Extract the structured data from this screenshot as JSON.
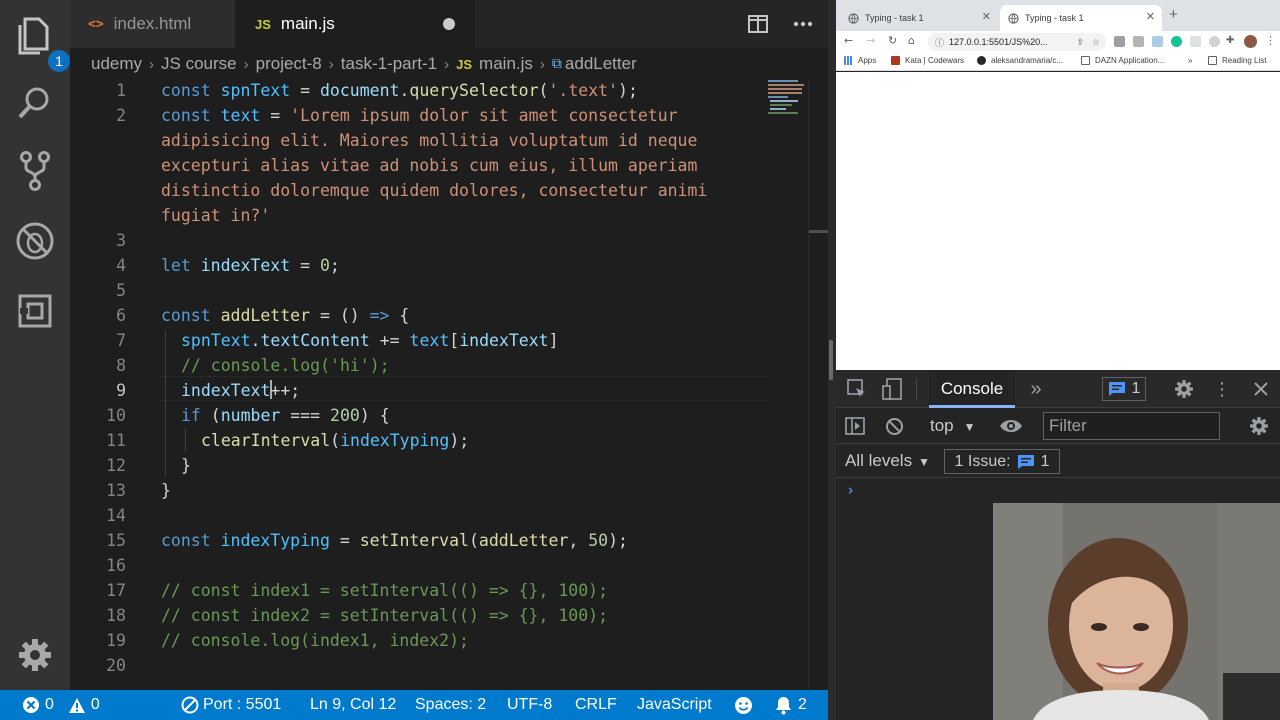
{
  "vscode": {
    "explorer_badge": "1",
    "tabs": [
      {
        "icon": "<>",
        "label": "index.html"
      },
      {
        "icon": "JS",
        "label": "main.js"
      }
    ],
    "breadcrumb": [
      "udemy",
      "JS course",
      "project-8",
      "task-1-part-1",
      "main.js",
      "addLetter"
    ],
    "breadcrumb_js_icon": "JS",
    "line_numbers": [
      "1",
      "2",
      "",
      "",
      "",
      "",
      "3",
      "4",
      "5",
      "6",
      "7",
      "8",
      "9",
      "10",
      "11",
      "12",
      "13",
      "14",
      "15",
      "16",
      "17",
      "18",
      "19",
      "20"
    ],
    "status": {
      "errors": "0",
      "warnings": "0",
      "port": "Port : 5501",
      "position": "Ln 9, Col 12",
      "spaces": "Spaces: 2",
      "encoding": "UTF-8",
      "eol": "CRLF",
      "language": "JavaScript",
      "notifications": "2"
    },
    "code": {
      "l1": {
        "k": "const",
        "v": "spnText",
        "eq": " = ",
        "o": "document",
        "d": ".",
        "f": "querySelector",
        "p1": "(",
        "s": "'.text'",
        "p2": ");"
      },
      "l2": {
        "k": "const",
        "v": "text",
        "eq": " = ",
        "s": "'Lorem ipsum dolor sit amet consectetur"
      },
      "l2b": "adipisicing elit. Maiores mollitia voluptatum id neque",
      "l2c": "excepturi alias vitae ad nobis cum eius, illum aperiam",
      "l2d": "distinctio doloremque quidem dolores, consectetur animi",
      "l2e": "fugiat in?'",
      "l4": {
        "k": "let",
        "v": "indexText",
        "eq": " = ",
        "n": "0",
        "e": ";"
      },
      "l6": {
        "k": "const",
        "f": "addLetter",
        "eq": " = () ",
        "a": "=>",
        "b": " {"
      },
      "l7": {
        "v1": "spnText",
        "d": ".",
        "p": "textContent",
        "op": " += ",
        "v2": "text",
        "b1": "[",
        "v3": "indexText",
        "b2": "]"
      },
      "l8": "// console.log('hi');",
      "l9": {
        "a": "indexText",
        "b": "++;"
      },
      "l10": {
        "k": "if",
        "p1": " (",
        "v": "number",
        "op": " === ",
        "n": "200",
        "p2": ") {"
      },
      "l11": {
        "f": "clearInterval",
        "p1": "(",
        "v": "indexTyping",
        "p2": ");"
      },
      "l12": "}",
      "l13": "}",
      "l15": {
        "k": "const",
        "v": "indexTyping",
        "eq": " = ",
        "f": "setInterval",
        "p1": "(",
        "a": "addLetter",
        "c": ", ",
        "n": "50",
        "p2": ");"
      },
      "l17": "// const index1 = setInterval(() => {}, 100);",
      "l18": "// const index2 = setInterval(() => {}, 100);",
      "l19": "// console.log(index1, index2);"
    }
  },
  "chrome": {
    "tabs": [
      "Typing - task 1",
      "Typing - task 1"
    ],
    "new_tab": "+",
    "url": "127.0.0.1:5501/JS%20...",
    "bookmarks": [
      "Apps",
      "Kata | Codewars",
      "aleksandramaria/c...",
      "DAZN Application...",
      "»",
      "Reading List"
    ]
  },
  "devtools": {
    "console_tab": "Console",
    "more_tabs": "»",
    "issue_count": "1",
    "context": "top",
    "filter_placeholder": "Filter",
    "levels": "All levels",
    "issues_label": "1 Issue:",
    "issues_count": "1",
    "prompt": "›"
  },
  "colors": {
    "statusbar": "#007acc",
    "activitybar": "#333333",
    "editor_bg": "#1e1e1e",
    "devtools_bg": "#242424"
  }
}
